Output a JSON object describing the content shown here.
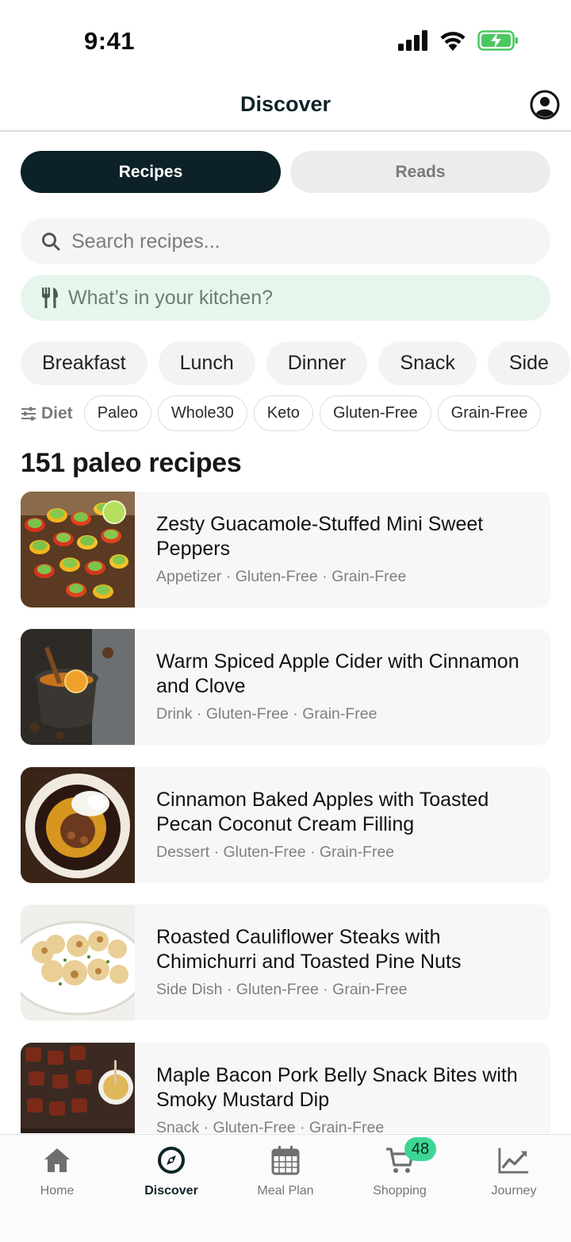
{
  "status_bar": {
    "time": "9:41"
  },
  "header": {
    "title": "Discover"
  },
  "segments": {
    "recipes": "Recipes",
    "reads": "Reads"
  },
  "search": {
    "placeholder": "Search recipes..."
  },
  "kitchen": {
    "placeholder": "What’s in your kitchen?"
  },
  "meal_types": [
    "Breakfast",
    "Lunch",
    "Dinner",
    "Snack",
    "Side"
  ],
  "diet": {
    "label": "Diet",
    "options": [
      "Paleo",
      "Whole30",
      "Keto",
      "Gluten-Free",
      "Grain-Free"
    ]
  },
  "results": {
    "count_label": "151 paleo recipes"
  },
  "recipes": [
    {
      "title": "Zesty Guacamole-Stuffed Mini Sweet Peppers",
      "meta": "Appetizer · Gluten-Free · Grain-Free",
      "image": "stuffed-peppers"
    },
    {
      "title": "Warm Spiced Apple Cider with Cinnamon and Clove",
      "meta": "Drink · Gluten-Free · Grain-Free",
      "image": "apple-cider"
    },
    {
      "title": "Cinnamon Baked Apples with Toasted Pecan Coconut Cream Filling",
      "meta": "Dessert · Gluten-Free · Grain-Free",
      "image": "baked-apple"
    },
    {
      "title": "Roasted Cauliflower Steaks with Chimichurri and Toasted Pine Nuts",
      "meta": "Side Dish · Gluten-Free · Grain-Free",
      "image": "cauliflower"
    },
    {
      "title": "Maple Bacon Pork Belly Snack Bites with Smoky Mustard Dip",
      "meta": "Snack · Gluten-Free · Grain-Free",
      "image": "pork-belly"
    }
  ],
  "tabbar": {
    "items": [
      {
        "label": "Home",
        "icon": "home-icon"
      },
      {
        "label": "Discover",
        "icon": "compass-icon"
      },
      {
        "label": "Meal Plan",
        "icon": "calendar-icon"
      },
      {
        "label": "Shopping",
        "icon": "cart-icon"
      },
      {
        "label": "Journey",
        "icon": "chart-icon"
      }
    ],
    "active": "Discover",
    "shopping_badge": "48"
  },
  "colors": {
    "primary": "#0c2128",
    "accent_green": "#3dd695",
    "kitchen_bg": "#e6f6ec"
  }
}
